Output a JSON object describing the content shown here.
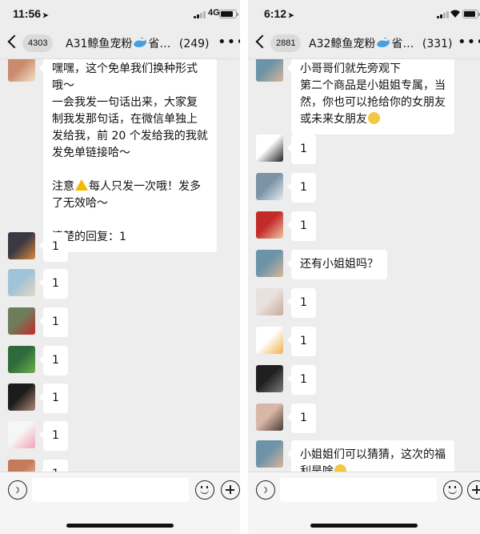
{
  "left": {
    "status": {
      "time": "11:56",
      "network": "4G",
      "battery_level": 0.85
    },
    "header": {
      "unread_count": "4303",
      "title": "A31鲸鱼宠粉",
      "title_suffix": "省…",
      "member_count": "(249)"
    },
    "messages": [
      {
        "avatar": "woman-portrait",
        "lines": [
          "嘿嘿，这个免单我们换种形式",
          "哦～",
          "一会我发一句话出来，大家复",
          "制我发那句话，在微信单独上",
          "发给我，前 20 个发给我的我就",
          "发免单链接哈～",
          "",
          "注意[warn]每人只发一次哦！发多",
          "了无效哈～",
          "",
          "清楚的回复：1"
        ]
      },
      {
        "avatar": "sunset-photo",
        "lines": [
          "1"
        ]
      },
      {
        "avatar": "beach-girl",
        "lines": [
          "1"
        ]
      },
      {
        "avatar": "red-figure",
        "lines": [
          "1"
        ]
      },
      {
        "avatar": "lotus-leaves",
        "lines": [
          "1"
        ]
      },
      {
        "avatar": "dark-portrait",
        "lines": [
          "1"
        ]
      },
      {
        "avatar": "peppa-pig",
        "lines": [
          "1"
        ]
      },
      {
        "avatar": "sky-photo",
        "lines": [
          "1"
        ]
      }
    ]
  },
  "right": {
    "status": {
      "time": "6:12",
      "battery_level": 0.9
    },
    "header": {
      "unread_count": "2881",
      "title": "A32鲸鱼宠粉",
      "title_suffix": "省…",
      "member_count": "(331)"
    },
    "messages": [
      {
        "avatar": "group-photo",
        "lines": [
          "小哥哥们就先旁观下",
          "第二个商品是小姐姐专属，当",
          "然，你也可以抢给你的女朋友",
          "或未来女朋友[emoji]"
        ]
      },
      {
        "avatar": "cartoon-girl",
        "lines": [
          "1"
        ]
      },
      {
        "avatar": "penguin",
        "lines": [
          "1"
        ]
      },
      {
        "avatar": "red-couple",
        "lines": [
          "1"
        ]
      },
      {
        "avatar": "group-photo",
        "lines": [
          "还有小姐姐吗？"
        ]
      },
      {
        "avatar": "doll-face",
        "lines": [
          "1"
        ]
      },
      {
        "avatar": "bald-cartoon",
        "lines": [
          "1"
        ]
      },
      {
        "avatar": "car-dashboard",
        "lines": [
          "1"
        ]
      },
      {
        "avatar": "girl-portrait",
        "lines": [
          "1"
        ]
      },
      {
        "avatar": "group-photo",
        "lines": [
          "小姐姐们可以猜猜，这次的福",
          "利是啥[emoji]"
        ]
      }
    ]
  },
  "colors": {
    "chat_bg": "#ededed",
    "bubble": "#ffffff",
    "input_bar": "#f5f5f5",
    "text": "#111111",
    "badge_bg": "#dadada"
  },
  "avatar_palette": {
    "woman-portrait": [
      "#c98a6e",
      "#f2e2c6"
    ],
    "sunset-photo": [
      "#3b3a44",
      "#d98a3a"
    ],
    "beach-girl": [
      "#9fc3d8",
      "#e8d7c2"
    ],
    "red-figure": [
      "#6e7d5a",
      "#c42a2a"
    ],
    "lotus-leaves": [
      "#2f6b3a",
      "#6fae4f"
    ],
    "dark-portrait": [
      "#1c1c1c",
      "#b08a78"
    ],
    "peppa-pig": [
      "#f6f6f6",
      "#f3a3b7"
    ],
    "sky-photo": [
      "#c57a5a",
      "#e9c9b4"
    ],
    "group-photo": [
      "#6c93a8",
      "#d7b69a"
    ],
    "cartoon-girl": [
      "#ffffff",
      "#222222"
    ],
    "penguin": [
      "#7c93a7",
      "#e4ebf0"
    ],
    "red-couple": [
      "#c32b2b",
      "#f0c7a6"
    ],
    "doll-face": [
      "#e8e2de",
      "#c9a89a"
    ],
    "bald-cartoon": [
      "#ffffff",
      "#f0b24a"
    ],
    "car-dashboard": [
      "#202020",
      "#7a7a7a"
    ],
    "girl-portrait": [
      "#d9b7a7",
      "#4a3b36"
    ]
  }
}
